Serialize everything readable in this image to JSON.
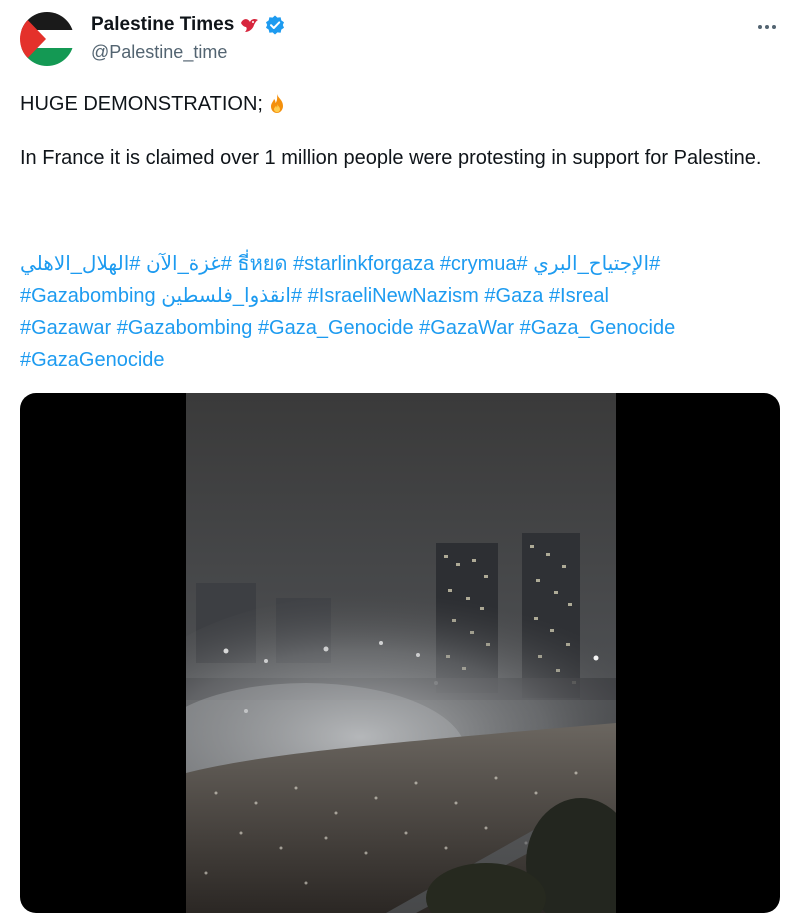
{
  "author": {
    "display_name": "Palestine Times",
    "handle": "@Palestine_time",
    "avatar": "palestine-flag",
    "badge_icons": [
      "red-bird-icon",
      "verified-badge-icon"
    ]
  },
  "tweet": {
    "headline": "HUGE DEMONSTRATION;",
    "headline_emoji": "fire-icon",
    "body": "In France it is claimed over 1 million people were protesting in support for Palestine."
  },
  "hashtag_lines": [
    [
      "#الهلال_الاهلي",
      "#غزة_الآن",
      "#crymua",
      "#starlinkforgaza",
      "#ธี่หยด",
      "#الإجتياح_البري"
    ],
    [
      "#Gazabombing",
      "#انقذوا_فلسطين",
      "#IsraeliNewNazism",
      "#Gaza",
      "#Isreal"
    ],
    [
      "#Gazawar",
      "#Gazabombing",
      "#Gaza_Genocide",
      "#GazaWar",
      "#Gaza_Genocide"
    ],
    [
      "#GazaGenocide"
    ]
  ],
  "media": {
    "type": "video",
    "subject": "night-crowd-protest-with-smoke-and-highrise-buildings"
  },
  "colors": {
    "link": "#1d9bf0",
    "text": "#0f1419",
    "muted": "#536471",
    "verified": "#1d9bf0",
    "media_bg": "#000000"
  }
}
